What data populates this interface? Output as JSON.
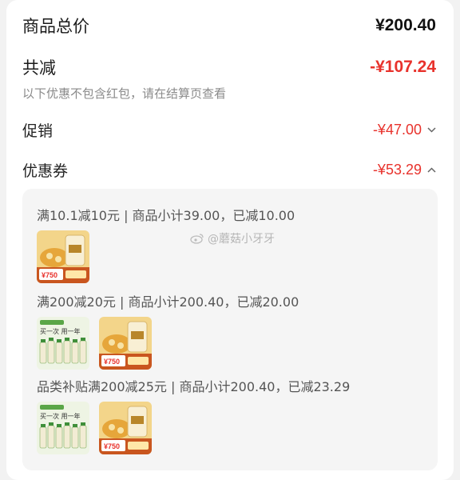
{
  "summary": {
    "total_label": "商品总价",
    "total_value": "¥200.40",
    "reduce_label": "共减",
    "reduce_value": "-¥107.24",
    "note": "以下优惠不包含红包，请在结算页查看"
  },
  "promotion": {
    "label": "促销",
    "value": "-¥47.00",
    "chevron": "chevron-down-icon"
  },
  "coupon": {
    "label": "优惠券",
    "value": "-¥53.29",
    "chevron": "chevron-up-icon"
  },
  "coupon_details": [
    {
      "text": "满10.1减10元 | 商品小计39.00，已减10.00",
      "products": [
        "soup-product-thumbnail"
      ]
    },
    {
      "text": "满200减20元 | 商品小计200.40，已减20.00",
      "products": [
        "bottle-product-thumbnail",
        "soup-product-thumbnail"
      ]
    },
    {
      "text": "品类补贴满200减25元 | 商品小计200.40，已减23.29",
      "products": [
        "bottle-product-thumbnail",
        "soup-product-thumbnail"
      ]
    }
  ],
  "thumbnails": {
    "bottle_banner": "买一次 用一年",
    "soup_price": "¥750"
  },
  "watermark": "@蘑菇小牙牙",
  "colors": {
    "red": "#e8322c",
    "panel_bg": "#f5f5f5",
    "text": "#1f1f1f",
    "muted": "#8a8a8a"
  }
}
